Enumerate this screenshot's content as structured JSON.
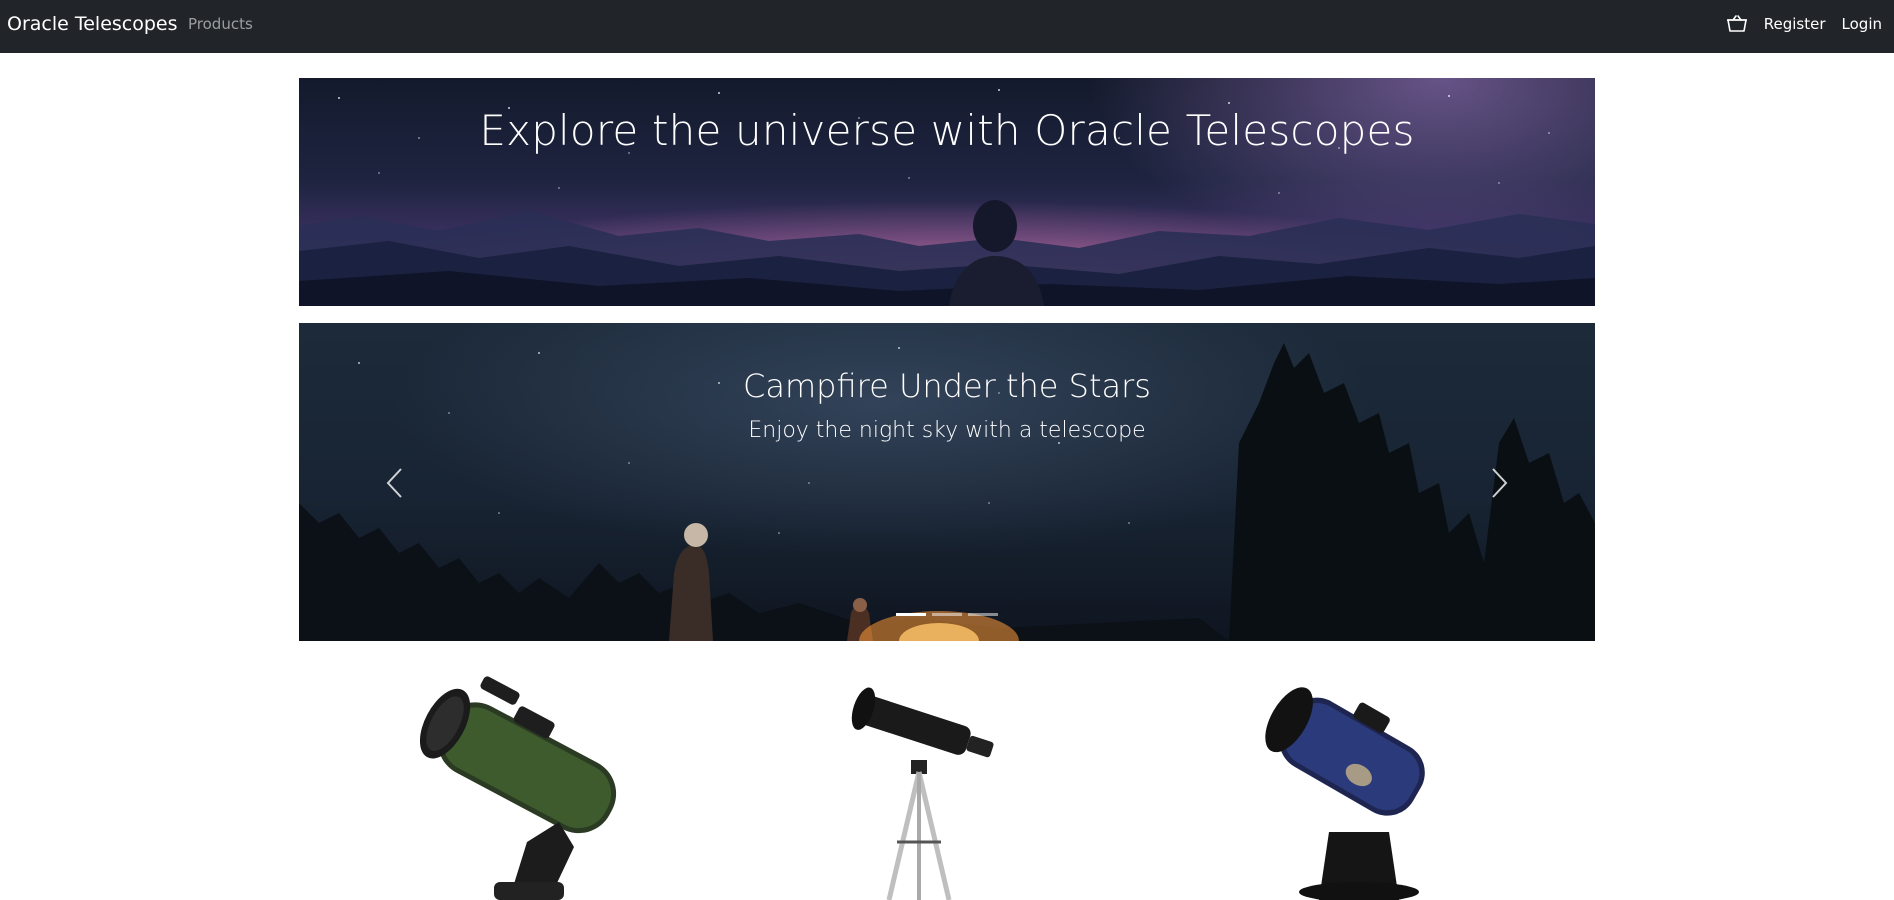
{
  "navbar": {
    "brand": "Oracle Telescopes",
    "products_link": "Products",
    "cart_icon": "cart-icon",
    "register": "Register",
    "login": "Login"
  },
  "hero": {
    "title": "Explore the universe with Oracle Telescopes"
  },
  "carousel": {
    "active_slide": 1,
    "slide_count": 3,
    "title": "Campfire Under the Stars",
    "subtitle": "Enjoy the night sky with a telescope",
    "prev_icon": "chevron-left-icon",
    "next_icon": "chevron-right-icon"
  },
  "products": [
    {
      "name": "green-reflector-telescope"
    },
    {
      "name": "refractor-telescope-on-tripod"
    },
    {
      "name": "blue-tabletop-dobsonian-telescope"
    }
  ],
  "colors": {
    "navbar_bg": "#212529",
    "nav_muted": "rgba(255,255,255,0.55)"
  }
}
